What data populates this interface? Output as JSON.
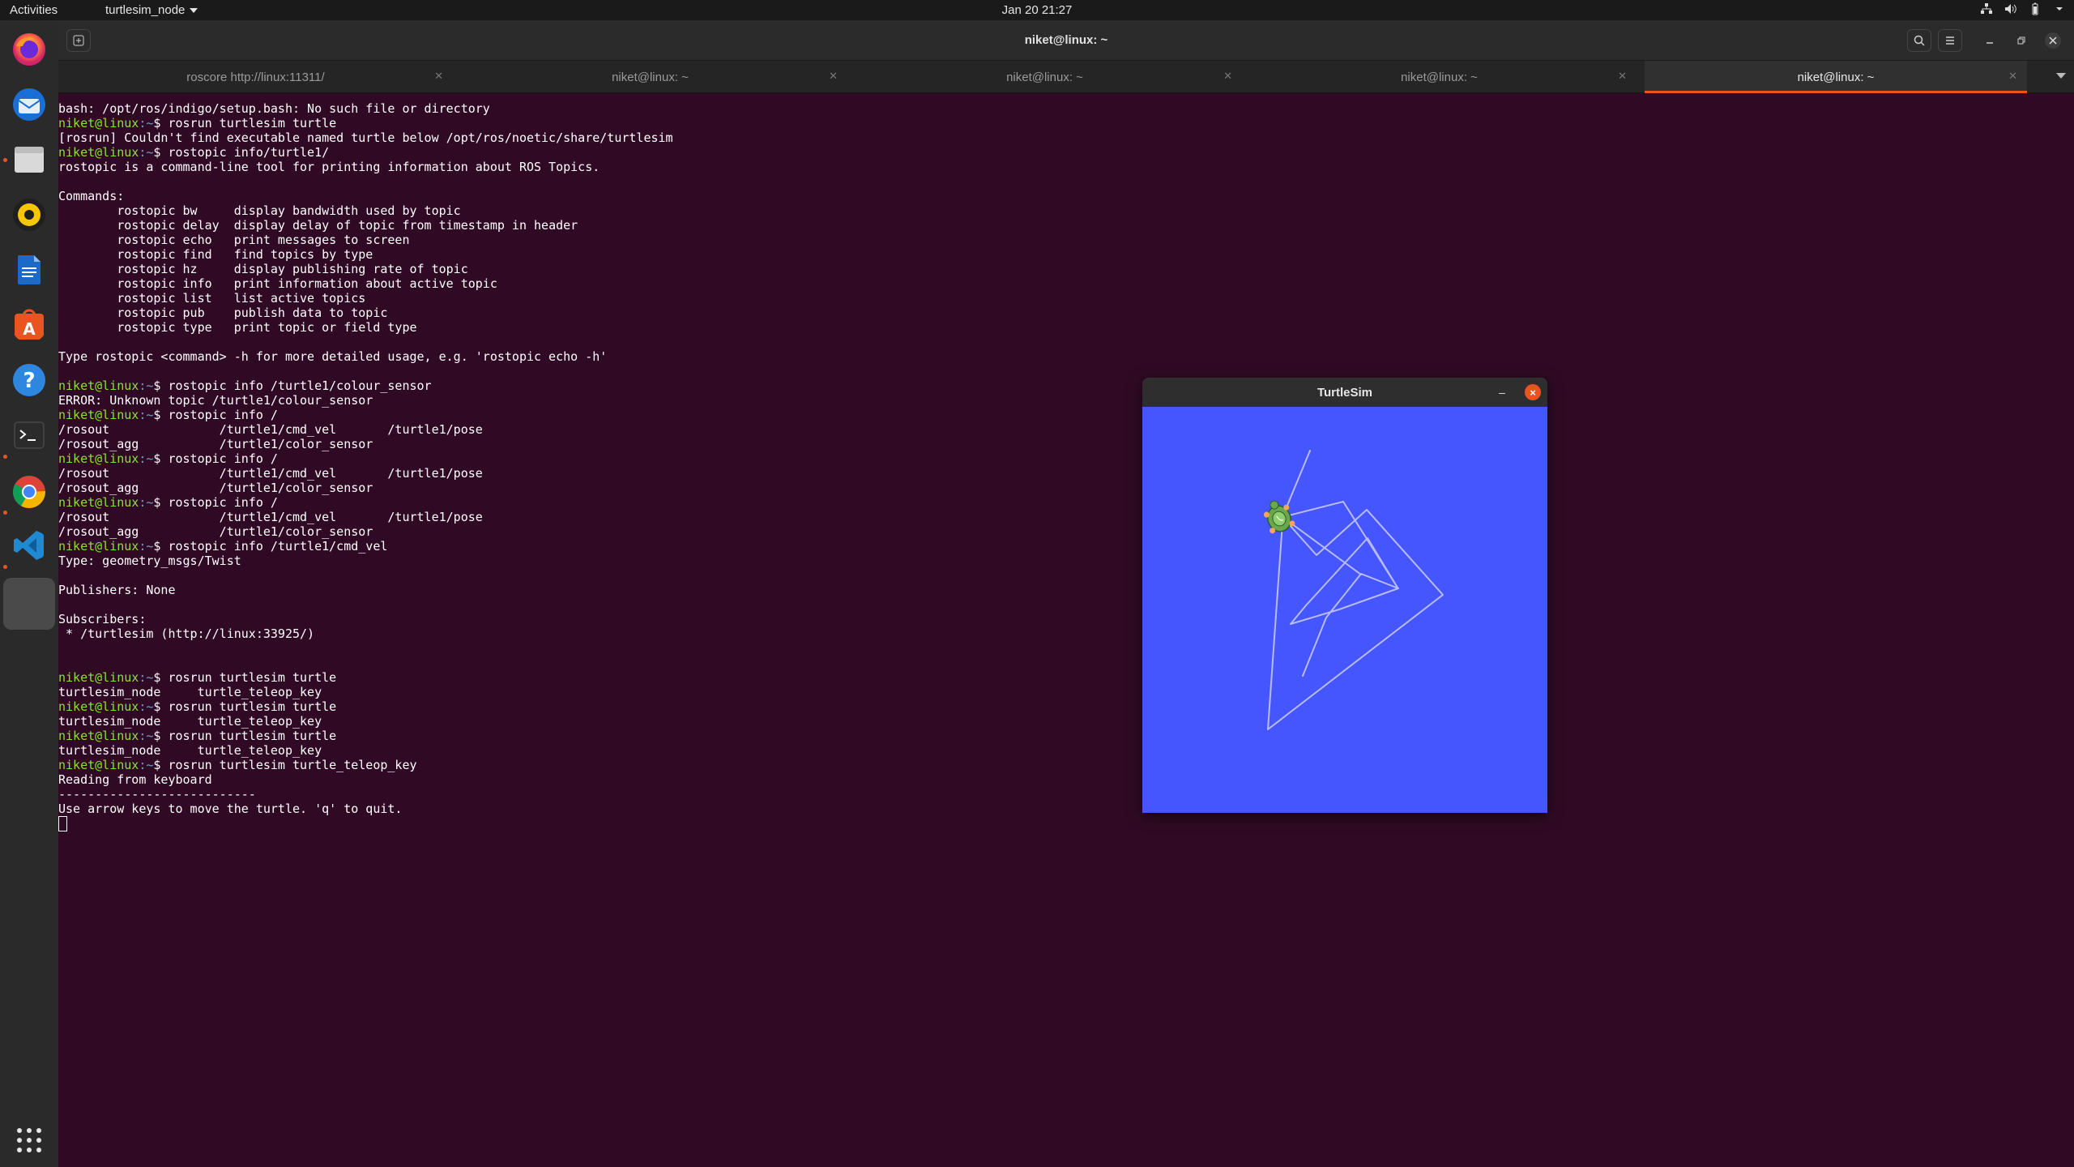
{
  "topbar": {
    "activities": "Activities",
    "app_menu": "turtlesim_node",
    "clock": "Jan 20  21:27",
    "icons": [
      "network-icon",
      "volume-icon",
      "battery-icon",
      "system-menu-icon"
    ]
  },
  "dock": {
    "items": [
      {
        "name": "firefox",
        "icon": "firefox-icon",
        "running": false
      },
      {
        "name": "thunderbird",
        "icon": "thunderbird-icon",
        "running": false
      },
      {
        "name": "files",
        "icon": "files-icon",
        "running": true
      },
      {
        "name": "rhythmbox",
        "icon": "rhythmbox-icon",
        "running": false
      },
      {
        "name": "libreoffice-writer",
        "icon": "writer-icon",
        "running": false
      },
      {
        "name": "ubuntu-software",
        "icon": "software-icon",
        "running": false
      },
      {
        "name": "help",
        "icon": "help-icon",
        "running": false
      },
      {
        "name": "terminal",
        "icon": "terminal-icon",
        "running": true
      },
      {
        "name": "chrome",
        "icon": "chrome-icon",
        "running": true
      },
      {
        "name": "vscode",
        "icon": "vscode-icon",
        "running": true
      },
      {
        "name": "turtlesim",
        "icon": "blank-app-icon",
        "running": true
      }
    ],
    "show_apps_icon": "grid-icon"
  },
  "terminal": {
    "title": "niket@linux: ~",
    "tabs": [
      {
        "label": "roscore http://linux:11311/"
      },
      {
        "label": "niket@linux: ~"
      },
      {
        "label": "niket@linux: ~"
      },
      {
        "label": "niket@linux: ~"
      },
      {
        "label": "niket@linux: ~"
      }
    ],
    "prompt_user": "niket@linux",
    "prompt_path": ":~",
    "lines": [
      {
        "t": "out",
        "text": "bash: /opt/ros/indigo/setup.bash: No such file or directory"
      },
      {
        "t": "cmd",
        "text": "$ rosrun turtlesim turtle"
      },
      {
        "t": "out",
        "text": "[rosrun] Couldn't find executable named turtle below /opt/ros/noetic/share/turtlesim"
      },
      {
        "t": "cmd",
        "text": "$ rostopic info/turtle1/"
      },
      {
        "t": "out",
        "text": "rostopic is a command-line tool for printing information about ROS Topics."
      },
      {
        "t": "out",
        "text": ""
      },
      {
        "t": "out",
        "text": "Commands:"
      },
      {
        "t": "out",
        "text": "\trostopic bw\tdisplay bandwidth used by topic"
      },
      {
        "t": "out",
        "text": "\trostopic delay\tdisplay delay of topic from timestamp in header"
      },
      {
        "t": "out",
        "text": "\trostopic echo\tprint messages to screen"
      },
      {
        "t": "out",
        "text": "\trostopic find\tfind topics by type"
      },
      {
        "t": "out",
        "text": "\trostopic hz\tdisplay publishing rate of topic"
      },
      {
        "t": "out",
        "text": "\trostopic info\tprint information about active topic"
      },
      {
        "t": "out",
        "text": "\trostopic list\tlist active topics"
      },
      {
        "t": "out",
        "text": "\trostopic pub\tpublish data to topic"
      },
      {
        "t": "out",
        "text": "\trostopic type\tprint topic or field type"
      },
      {
        "t": "out",
        "text": ""
      },
      {
        "t": "out",
        "text": "Type rostopic <command> -h for more detailed usage, e.g. 'rostopic echo -h'"
      },
      {
        "t": "out",
        "text": ""
      },
      {
        "t": "cmd",
        "text": "$ rostopic info /turtle1/colour_sensor"
      },
      {
        "t": "out",
        "text": "ERROR: Unknown topic /turtle1/colour_sensor"
      },
      {
        "t": "cmd",
        "text": "$ rostopic info /"
      },
      {
        "t": "out",
        "text": "/rosout               /turtle1/cmd_vel       /turtle1/pose"
      },
      {
        "t": "out",
        "text": "/rosout_agg           /turtle1/color_sensor"
      },
      {
        "t": "cmd",
        "text": "$ rostopic info /"
      },
      {
        "t": "out",
        "text": "/rosout               /turtle1/cmd_vel       /turtle1/pose"
      },
      {
        "t": "out",
        "text": "/rosout_agg           /turtle1/color_sensor"
      },
      {
        "t": "cmd",
        "text": "$ rostopic info /"
      },
      {
        "t": "out",
        "text": "/rosout               /turtle1/cmd_vel       /turtle1/pose"
      },
      {
        "t": "out",
        "text": "/rosout_agg           /turtle1/color_sensor"
      },
      {
        "t": "cmd",
        "text": "$ rostopic info /turtle1/cmd_vel"
      },
      {
        "t": "out",
        "text": "Type: geometry_msgs/Twist"
      },
      {
        "t": "out",
        "text": ""
      },
      {
        "t": "out",
        "text": "Publishers: None"
      },
      {
        "t": "out",
        "text": ""
      },
      {
        "t": "out",
        "text": "Subscribers:"
      },
      {
        "t": "out",
        "text": " * /turtlesim (http://linux:33925/)"
      },
      {
        "t": "out",
        "text": ""
      },
      {
        "t": "out",
        "text": ""
      },
      {
        "t": "cmd",
        "text": "$ rosrun turtlesim turtle"
      },
      {
        "t": "out",
        "text": "turtlesim_node     turtle_teleop_key"
      },
      {
        "t": "cmd",
        "text": "$ rosrun turtlesim turtle"
      },
      {
        "t": "out",
        "text": "turtlesim_node     turtle_teleop_key"
      },
      {
        "t": "cmd",
        "text": "$ rosrun turtlesim turtle"
      },
      {
        "t": "out",
        "text": "turtlesim_node     turtle_teleop_key"
      },
      {
        "t": "cmd",
        "text": "$ rosrun turtlesim turtle_teleop_key"
      },
      {
        "t": "out",
        "text": "Reading from keyboard"
      },
      {
        "t": "out",
        "text": "---------------------------"
      },
      {
        "t": "out",
        "text": "Use arrow keys to move the turtle. 'q' to quit."
      }
    ]
  },
  "turtlesim": {
    "title": "TurtleSim",
    "min_label": "–",
    "close_label": "×",
    "colors": {
      "background": "#4556ff",
      "pen": "#b3b8ff",
      "turtle": "#6aa84f"
    }
  }
}
